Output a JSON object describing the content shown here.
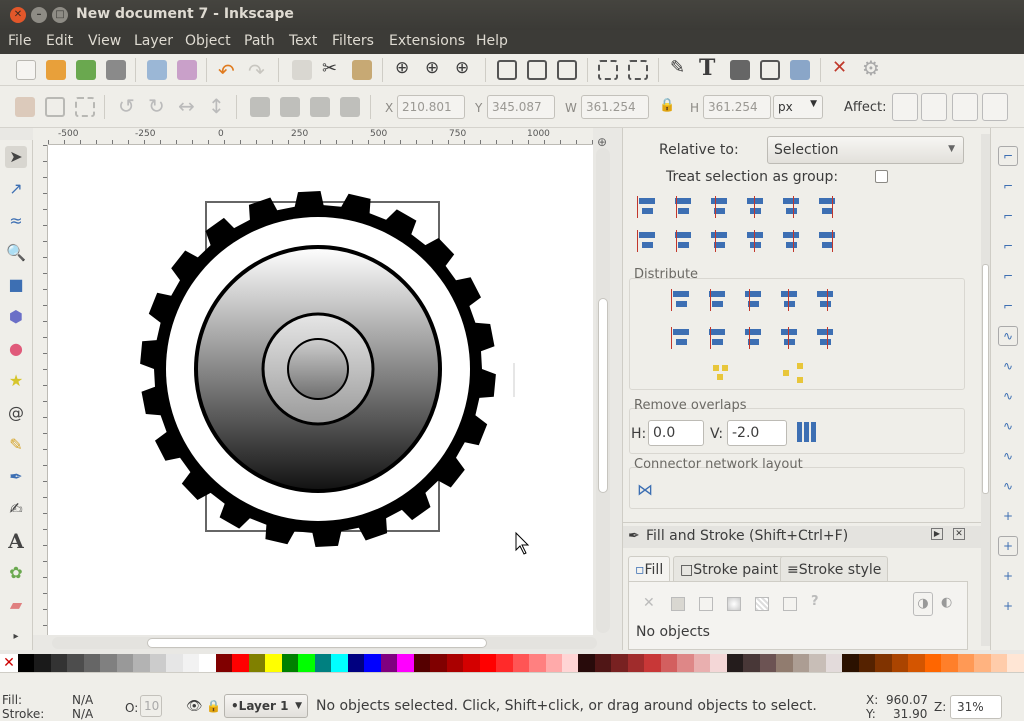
{
  "window": {
    "title": "New document 7 - Inkscape"
  },
  "menu": [
    "File",
    "Edit",
    "View",
    "Layer",
    "Object",
    "Path",
    "Text",
    "Filters",
    "Extensions",
    "Help"
  ],
  "toolbar": {
    "x_label": "X",
    "x_value": "210.801",
    "y_label": "Y",
    "y_value": "345.087",
    "w_label": "W",
    "w_value": "361.254",
    "h_label": "H",
    "h_value": "361.254",
    "unit": "px",
    "affect_label": "Affect:"
  },
  "ruler": {
    "h_ticks": [
      "-500",
      "-250",
      "0",
      "250",
      "500",
      "750",
      "1000"
    ]
  },
  "align_panel": {
    "relative_to_label": "Relative to:",
    "relative_to_value": "Selection",
    "treat_group_label": "Treat selection as group:",
    "distribute_title": "Distribute",
    "remove_overlaps_title": "Remove overlaps",
    "h_label": "H:",
    "h_value": "0.0",
    "v_label": "V:",
    "v_value": "-2.0",
    "connector_title": "Connector network layout"
  },
  "fill_stroke": {
    "title": "Fill and Stroke (Shift+Ctrl+F)",
    "tabs": [
      "Fill",
      "Stroke paint",
      "Stroke style"
    ],
    "no_objects": "No objects"
  },
  "status": {
    "fill_label": "Fill:",
    "fill_value": "N/A",
    "stroke_label": "Stroke:",
    "stroke_value": "N/A",
    "opacity_label": "O:",
    "opacity_value": "10",
    "layer": "•Layer 1",
    "message": "No objects selected. Click, Shift+click, or drag around objects to select.",
    "x_label": "X:",
    "x_value": "960.07",
    "y_label": "Y:",
    "y_value": "31.90",
    "z_label": "Z:",
    "zoom": "31%"
  },
  "palette": [
    "#000000",
    "#1a1a1a",
    "#333333",
    "#4d4d4d",
    "#666666",
    "#808080",
    "#999999",
    "#b3b3b3",
    "#cccccc",
    "#e6e6e6",
    "#f2f2f2",
    "#ffffff",
    "#800000",
    "#ff0000",
    "#808000",
    "#ffff00",
    "#008000",
    "#00ff00",
    "#008080",
    "#00ffff",
    "#000080",
    "#0000ff",
    "#800080",
    "#ff00ff",
    "#550000",
    "#800000",
    "#aa0000",
    "#d40000",
    "#ff0000",
    "#ff2a2a",
    "#ff5555",
    "#ff8080",
    "#ffaaaa",
    "#ffd5d5",
    "#280b0b",
    "#501616",
    "#782121",
    "#a02c2c",
    "#c83737",
    "#d35f5f",
    "#de8787",
    "#e9afaf",
    "#f4d7d7",
    "#241c1c",
    "#483737",
    "#6c5353",
    "#917c6f",
    "#ac9d93",
    "#c8beb7",
    "#e3dbdb",
    "#2b1100",
    "#552200",
    "#803300",
    "#aa4400",
    "#d45500",
    "#ff6600",
    "#ff7f2a",
    "#ff9955",
    "#ffb380",
    "#ffccaa",
    "#ffe6d5"
  ],
  "colors": {
    "accent": "#3d6fb3",
    "titlebar": "#3c3b37"
  }
}
